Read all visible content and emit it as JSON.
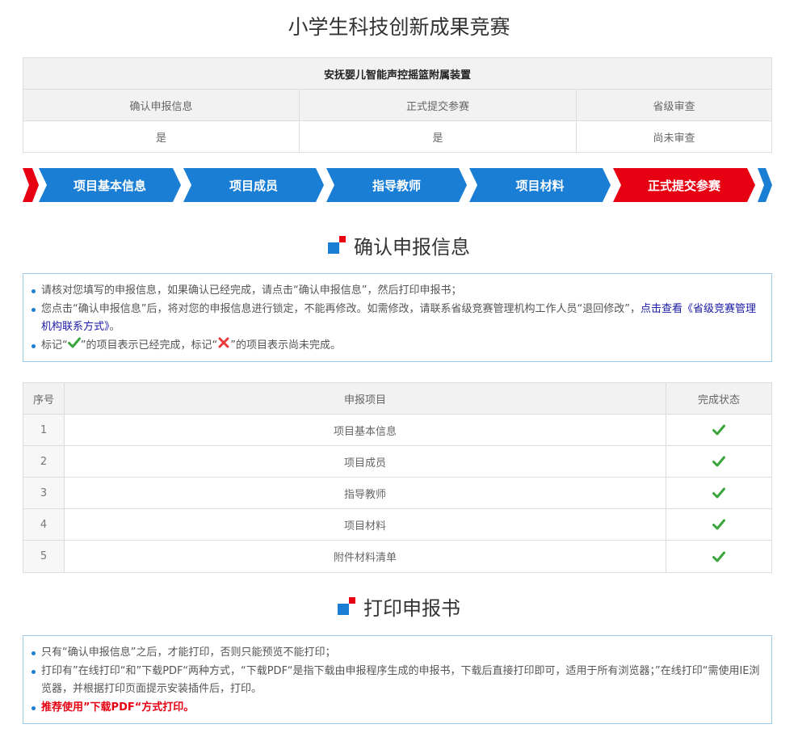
{
  "page": {
    "title": "小学生科技创新成果竞赛"
  },
  "project": {
    "name": "安抚婴儿智能声控摇篮附属装置",
    "headers": [
      "确认申报信息",
      "正式提交参赛",
      "省级审查"
    ],
    "values": [
      "是",
      "是",
      "尚未审查"
    ]
  },
  "steps": [
    {
      "label": "项目基本信息",
      "state": "done"
    },
    {
      "label": "项目成员",
      "state": "done"
    },
    {
      "label": "指导教师",
      "state": "done"
    },
    {
      "label": "项目材料",
      "state": "done"
    },
    {
      "label": "正式提交参赛",
      "state": "active"
    }
  ],
  "colors": {
    "step_blue": "#1a7fd4",
    "step_red": "#e60012",
    "check_green": "#3aa53a"
  },
  "confirm_section": {
    "title": "确认申报信息",
    "notes": {
      "line1": "请核对您填写的申报信息，如果确认已经完成，请点击“确认申报信息”，然后打印申报书；",
      "line2_text": "您点击“确认申报信息”后，将对您的申报信息进行锁定，不能再修改。如需修改，请联系省级竞赛管理机构工作人员“退回修改”，",
      "line2_link": "点击查看《省级竞赛管理机构联系方式》",
      "line2_end": "。",
      "line3_a": "标记“",
      "line3_b": "”的项目表示已经完成，标记“",
      "line3_c": "”的项目表示尚未完成。",
      "check_icon": "check-icon",
      "x_icon": "x-icon"
    }
  },
  "status_table": {
    "headers": [
      "序号",
      "申报项目",
      "完成状态"
    ],
    "rows": [
      {
        "no": "1",
        "item": "项目基本信息",
        "status": "check-icon"
      },
      {
        "no": "2",
        "item": "项目成员",
        "status": "check-icon"
      },
      {
        "no": "3",
        "item": "指导教师",
        "status": "check-icon"
      },
      {
        "no": "4",
        "item": "项目材料",
        "status": "check-icon"
      },
      {
        "no": "5",
        "item": "附件材料清单",
        "status": "check-icon"
      }
    ]
  },
  "print_section": {
    "title": "打印申报书",
    "notes": {
      "line1": "只有“确认申报信息”之后，才能打印，否则只能预览不能打印；",
      "line2": "打印有”在线打印“和”下载PDF“两种方式，“下载PDF“是指下载由申报程序生成的申报书，下载后直接打印即可，适用于所有浏览器；”在线打印“需使用IE浏览器，并根据打印页面提示安装插件后，打印。",
      "line3": "推荐使用”下载PDF“方式打印。"
    }
  }
}
